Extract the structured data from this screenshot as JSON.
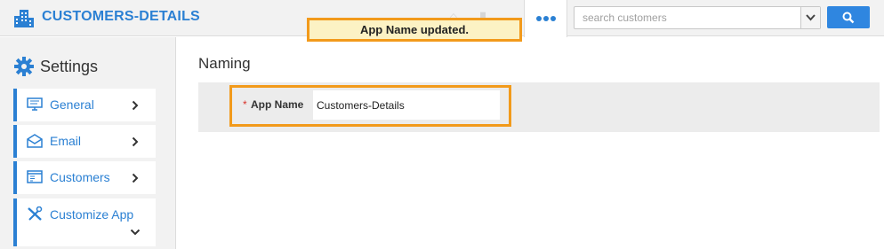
{
  "header": {
    "app_title": "CUSTOMERS-DETAILS",
    "logo_icon": "building-icon",
    "more_icon": "more-dots-icon",
    "search_placeholder": "search customers",
    "search_button_icon": "search-icon",
    "dropdown_icon": "chevron-down-icon",
    "accent_color": "#2b80d3"
  },
  "toast": {
    "message": "App Name updated.",
    "background": "#fcf2c4",
    "border_color": "#f29a1b"
  },
  "sidebar": {
    "title": "Settings",
    "title_icon": "gear-icon",
    "items": [
      {
        "label": "General",
        "icon": "monitor-icon",
        "expanded": false
      },
      {
        "label": "Email",
        "icon": "envelope-icon",
        "expanded": false
      },
      {
        "label": "Customers",
        "icon": "window-icon",
        "expanded": false
      },
      {
        "label": "Customize App",
        "icon": "tools-icon",
        "expanded": true
      }
    ]
  },
  "main": {
    "section_title": "Naming",
    "fields": [
      {
        "label": "App Name",
        "required_mark": "*",
        "value": "Customers-Details"
      }
    ]
  }
}
